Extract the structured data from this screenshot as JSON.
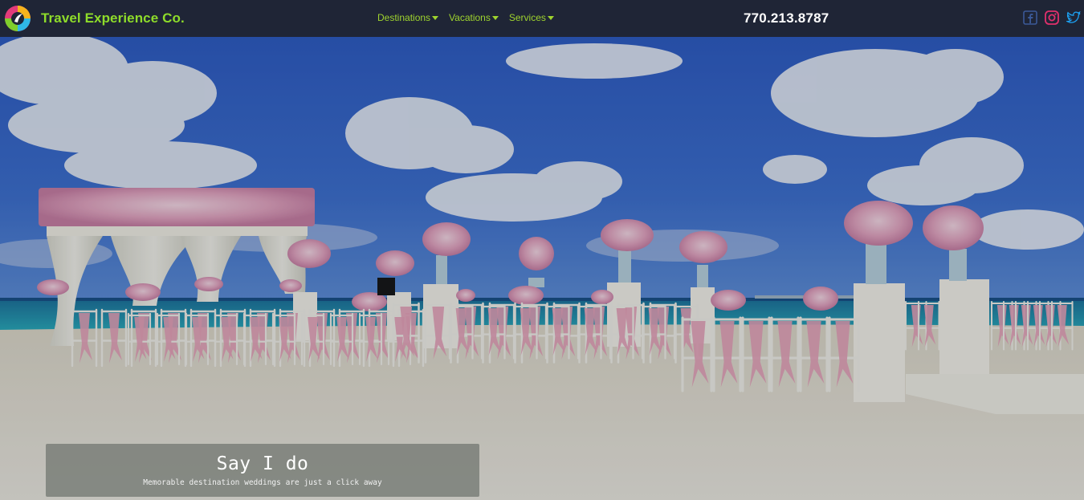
{
  "brand": {
    "name": "Travel Experience Co."
  },
  "nav": {
    "items": [
      {
        "label": "Destinations"
      },
      {
        "label": "Vacations"
      },
      {
        "label": "Services"
      }
    ]
  },
  "contact": {
    "phone": "770.213.8787"
  },
  "social": [
    {
      "name": "facebook-icon",
      "color": "#3b5998"
    },
    {
      "name": "instagram-icon",
      "color": "#e1306c"
    },
    {
      "name": "twitter-icon",
      "color": "#1da1f2"
    }
  ],
  "hero": {
    "title": "Say I do",
    "subtitle": "Memorable destination weddings are just a click away"
  },
  "colors": {
    "nav_bg": "#1f2536",
    "brand_green": "#8edc2a",
    "nav_link": "#9fd42e",
    "sky": "#2f5fbf",
    "sea": "#1f9bb0",
    "sand": "#e9e6dc",
    "ribbon": "#e7a2b8"
  }
}
